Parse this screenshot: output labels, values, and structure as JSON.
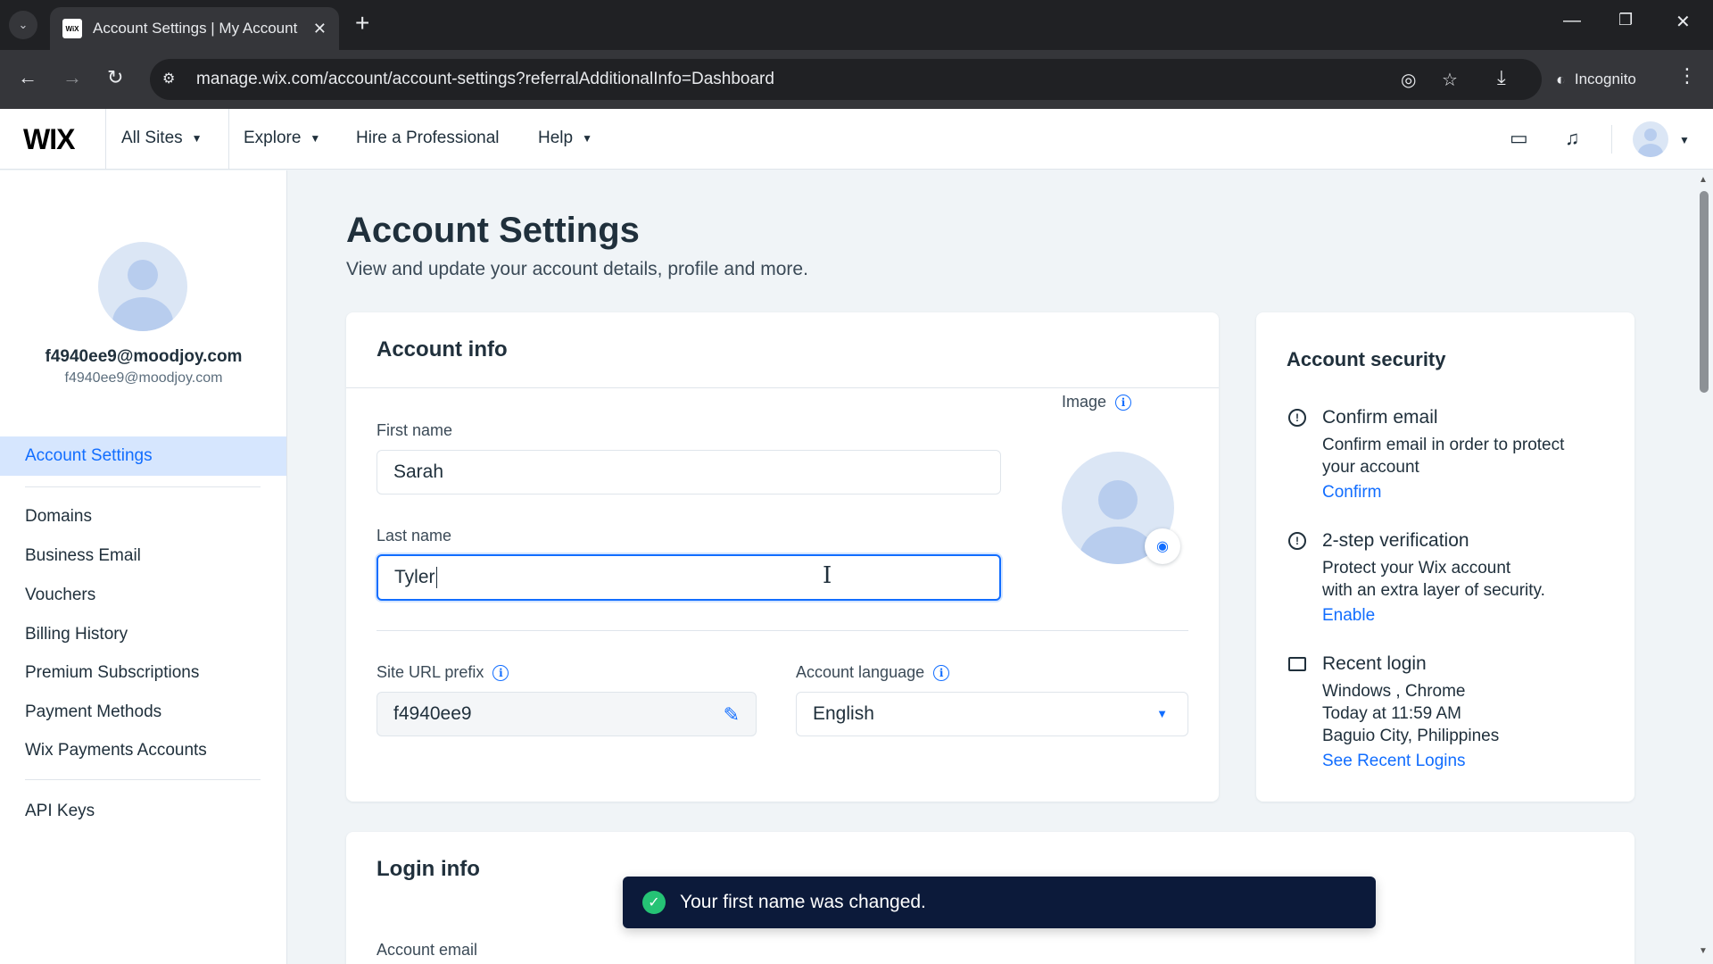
{
  "browser": {
    "tab_title": "Account Settings | My Account",
    "favicon_text": "WiX",
    "url": "manage.wix.com/account/account-settings?referralAdditionalInfo=Dashboard",
    "incognito_label": "Incognito"
  },
  "header": {
    "logo": "WIX",
    "nav": [
      "All Sites",
      "Explore",
      "Hire a Professional",
      "Help"
    ]
  },
  "sidebar": {
    "email_primary": "f4940ee9@moodjoy.com",
    "email_secondary": "f4940ee9@moodjoy.com",
    "items": [
      "Account Settings",
      "Domains",
      "Business Email",
      "Vouchers",
      "Billing History",
      "Premium Subscriptions",
      "Payment Methods",
      "Wix Payments Accounts",
      "API Keys"
    ]
  },
  "main": {
    "title": "Account Settings",
    "subtitle": "View and update your account details, profile and more."
  },
  "account_info": {
    "title": "Account info",
    "first_name_label": "First name",
    "first_name_value": "Sarah",
    "last_name_label": "Last name",
    "last_name_value": "Tyler",
    "image_label": "Image",
    "site_url_label": "Site URL prefix",
    "site_url_value": "f4940ee9",
    "language_label": "Account language",
    "language_value": "English"
  },
  "account_security": {
    "title": "Account security",
    "confirm_email_title": "Confirm email",
    "confirm_email_text": [
      "Confirm email in order to protect",
      "your account"
    ],
    "confirm_link": "Confirm",
    "two_step_title": "2-step verification",
    "two_step_text": [
      "Protect your Wix account",
      "with an extra layer of security."
    ],
    "enable_link": "Enable",
    "recent_login_title": "Recent login",
    "recent_login_text": [
      "Windows , Chrome",
      "Today at 11:59 AM",
      "Baguio City, Philippines"
    ],
    "see_logins_link": "See Recent Logins"
  },
  "login_info": {
    "title": "Login info",
    "account_email_label": "Account email"
  },
  "toast": {
    "message": "Your first name was changed."
  },
  "colors": {
    "accent": "#116dff",
    "toast_bg": "#0c1a3a",
    "success": "#25c375"
  }
}
